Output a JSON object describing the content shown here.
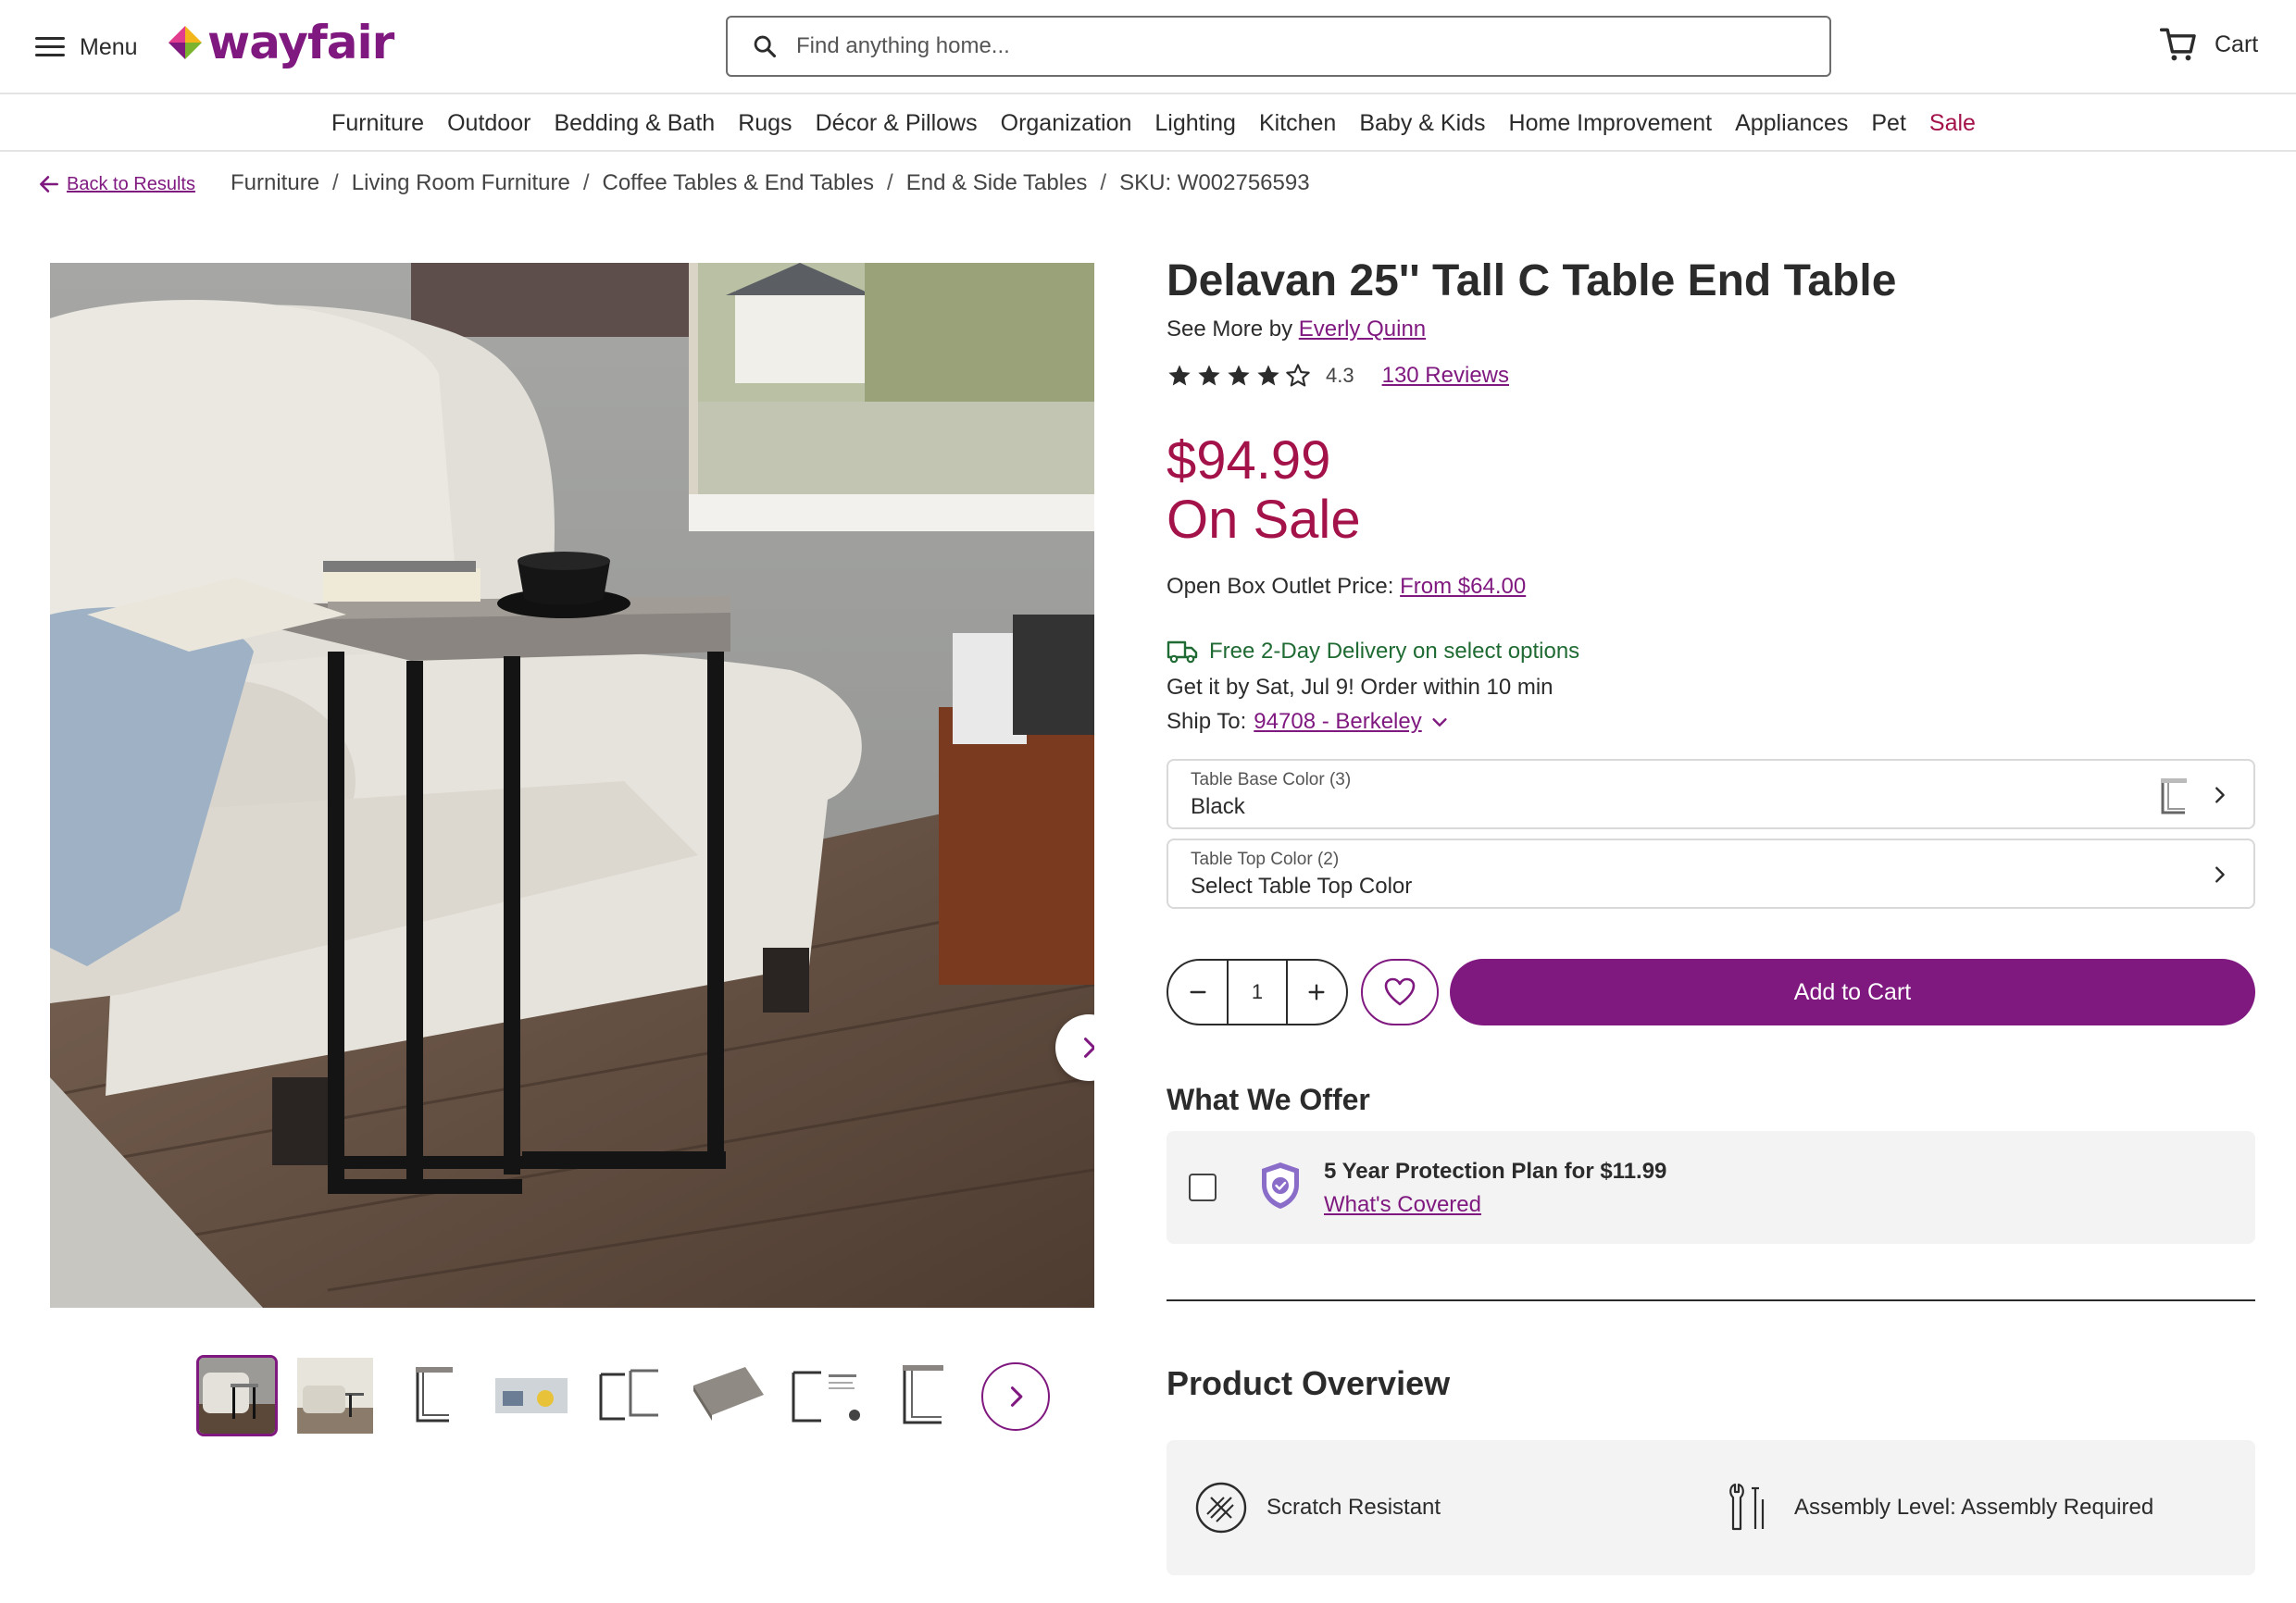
{
  "header": {
    "menu_label": "Menu",
    "logo_text": "wayfair",
    "search_placeholder": "Find anything home...",
    "cart_label": "Cart"
  },
  "categories": [
    "Furniture",
    "Outdoor",
    "Bedding & Bath",
    "Rugs",
    "Décor & Pillows",
    "Organization",
    "Lighting",
    "Kitchen",
    "Baby & Kids",
    "Home Improvement",
    "Appliances",
    "Pet",
    "Sale"
  ],
  "breadcrumb": {
    "back_label": "Back to Results",
    "items": [
      "Furniture",
      "Living Room Furniture",
      "Coffee Tables & End Tables",
      "End & Side Tables"
    ],
    "sku": "SKU: W002756593"
  },
  "product": {
    "title": "Delavan 25'' Tall C Table End Table",
    "see_more_prefix": "See More by",
    "brand": "Everly Quinn",
    "rating": "4.3",
    "rating_value": 4.3,
    "reviews": "130 Reviews",
    "price": "$94.99",
    "sale_label": "On Sale",
    "open_box_label": "Open Box Outlet Price:",
    "open_box_price": "From $64.00",
    "delivery": "Free 2-Day Delivery on select options",
    "get_it": "Get it by Sat, Jul 9! Order within 10 min",
    "ship_to_label": "Ship To:",
    "ship_to_value": "94708 - Berkeley"
  },
  "options": [
    {
      "label": "Table Base Color (3)",
      "value": "Black"
    },
    {
      "label": "Table Top Color (2)",
      "value": "Select Table Top Color"
    }
  ],
  "cart_controls": {
    "quantity": "1",
    "add_to_cart": "Add to Cart"
  },
  "offers": {
    "heading": "What We Offer",
    "plan": "5 Year Protection Plan for $11.99",
    "link": "What's Covered"
  },
  "overview": {
    "heading": "Product Overview",
    "features": [
      "Scratch Resistant",
      "Assembly Level: Assembly Required"
    ]
  },
  "colors": {
    "brand_purple": "#7f187f",
    "sale_red": "#a4124a",
    "delivery_green": "#1f6b33",
    "text": "#2b2b2b"
  },
  "icons": [
    "menu-icon",
    "search-icon",
    "cart-icon",
    "arrow-left-icon",
    "chevron-right-icon",
    "star-icon",
    "truck-icon",
    "chevron-down-icon",
    "minus-icon",
    "plus-icon",
    "heart-icon",
    "shield-check-icon",
    "scratch-resistant-icon",
    "wrench-icon"
  ]
}
